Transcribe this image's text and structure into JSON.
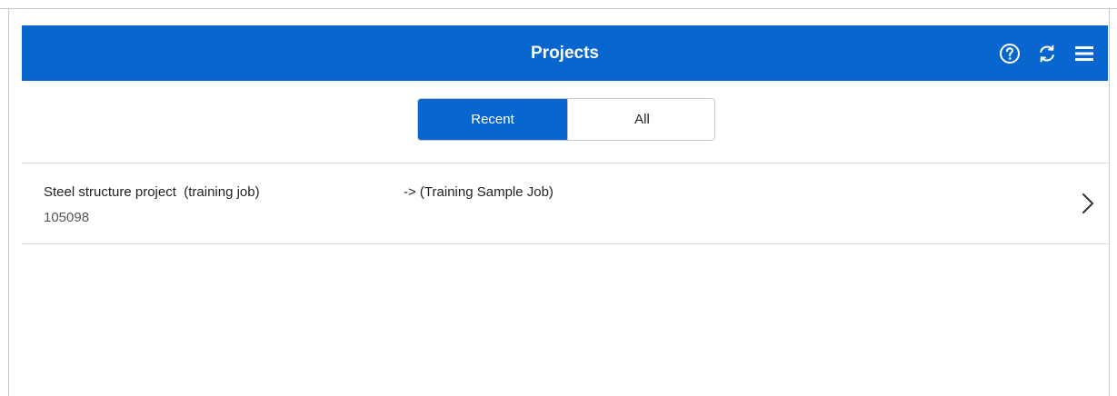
{
  "header": {
    "title": "Projects",
    "icons": [
      "help-icon",
      "sync-icon",
      "menu-icon"
    ],
    "background": "#0a66cf"
  },
  "filter": {
    "recent_label": "Recent",
    "all_label": "All",
    "selected": "Recent"
  },
  "projects": [
    {
      "name": "Steel structure project  (training job)",
      "id": "105098",
      "subtitle": "-> (Training Sample Job)"
    }
  ]
}
